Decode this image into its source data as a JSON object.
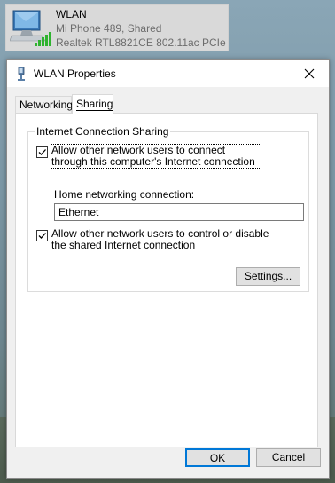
{
  "network_tile": {
    "name": "WLAN",
    "status": "Mi Phone 489, Shared",
    "device": "Realtek RTL8821CE 802.11ac PCIe ...",
    "icon": "wifi-network-icon"
  },
  "dialog": {
    "title": "WLAN Properties",
    "close_label": "×",
    "tabs": [
      {
        "label": "Networking",
        "active": false
      },
      {
        "label": "Sharing",
        "active": true
      }
    ],
    "group_title": "Internet Connection Sharing",
    "allow_connect": {
      "checked": true,
      "label": "Allow other network users to connect through this computer's Internet connection"
    },
    "home_networking": {
      "label": "Home networking connection:",
      "value": "Ethernet"
    },
    "allow_control": {
      "checked": true,
      "label": "Allow other network users to control or disable the shared Internet connection"
    },
    "settings_label": "Settings...",
    "ok_label": "OK",
    "cancel_label": "Cancel"
  },
  "colors": {
    "accent": "#0078d7",
    "signal_green": "#2fb32f",
    "dialog_bg": "#f0f0f0"
  }
}
